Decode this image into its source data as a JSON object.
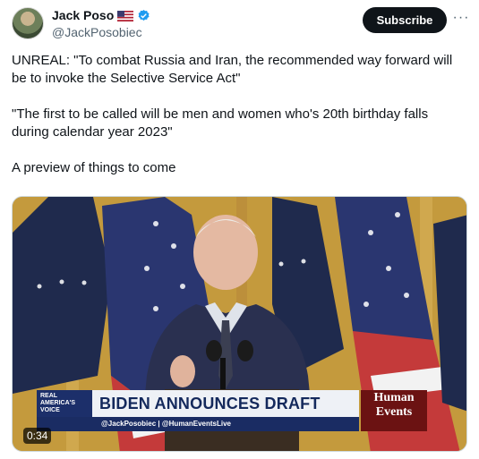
{
  "author": {
    "name": "Jack Poso",
    "handle": "@JackPosobiec",
    "flag": "us-flag-icon",
    "verified": "verified-badge-icon"
  },
  "actions": {
    "subscribe_label": "Subscribe",
    "more_label": "···"
  },
  "tweet": {
    "paragraphs": [
      "UNREAL: \"To combat Russia and Iran, the recommended way forward will be to invoke the Selective Service Act\"",
      "\"The first to be called will be men and women who's 20th birthday falls during calendar year 2023\"",
      "A preview of things to come"
    ]
  },
  "video": {
    "duration": "0:34",
    "chyron": {
      "logo_lines": [
        "REAL",
        "AMERICA'S",
        "VOICE"
      ],
      "headline": "BIDEN ANNOUNCES DRAFT",
      "subline": "@JackPosobiec | @HumanEventsLive"
    },
    "brand": {
      "title_line1": "Human",
      "title_line2": "Events"
    }
  },
  "colors": {
    "text": "#0f1419",
    "secondary": "#536471",
    "verified": "#1d9bf0",
    "chyron_navy": "#14295c",
    "brand_red": "#6b1212"
  }
}
